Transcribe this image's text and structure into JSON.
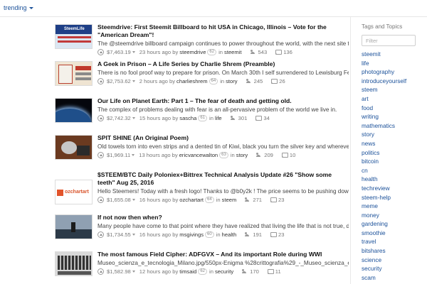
{
  "header": {
    "sort_label": "trending"
  },
  "posts": [
    {
      "title": "Steemdrive: First Steemit Billboard to hit USA in Chicago, Illinois – Vote for the \"American Dream\"!",
      "summary": "The @steemdrive billboard campaign continues to power throughout the world, with the next site targeted in",
      "payout": "$7,463.19",
      "time": "23 hours ago",
      "author": "steemdrive",
      "rep": "62",
      "category": "steemit",
      "votes": "543",
      "comments": "136"
    },
    {
      "title": "A Geek in Prison – A Life Series by Charlie Shrem (Preamble)",
      "summary": "There is no fool proof way to prepare for prison. On March 30th I self surrendered to Lewisburg Federal P",
      "payout": "$2,753.62",
      "time": "2 hours ago",
      "author": "charlieshrem",
      "rep": "64",
      "category": "story",
      "votes": "245",
      "comments": "26"
    },
    {
      "title": "Our Life on Planet Earth: Part 1 – The fear of death and getting old.",
      "summary": "The complex of problems dealing with fear is an all-pervasive problem of the world we live in.",
      "payout": "$2,742.32",
      "time": "15 hours ago",
      "author": "sascha",
      "rep": "61",
      "category": "life",
      "votes": "301",
      "comments": "34"
    },
    {
      "title": "SPIT SHINE (An Original Poem)",
      "summary": "Old towels torn into even strips and a dented tin of Kiwi, black you turn the silver key and wherever you",
      "payout": "$1,969.11",
      "time": "13 hours ago",
      "author": "ericvancewalton",
      "rep": "63",
      "category": "story",
      "votes": "209",
      "comments": "10"
    },
    {
      "title": "$STEEM/BTC Daily Poloniex+Bittrex Technical Analysis Update #26 \"Show some teeth\" Aug 25, 2016",
      "summary": "Hello Steemers! Today with a fresh logo! Thanks to @b0y2k ! The price seems to be pushing down but is ot",
      "payout": "$1,655.08",
      "time": "16 hours ago",
      "author": "ozchartart",
      "rep": "64",
      "category": "steem",
      "votes": "271",
      "comments": "23"
    },
    {
      "title": "If not now then when?",
      "summary": "Many people have come to that point where they have realized that living the life that is not true, does no",
      "payout": "$1,734.55",
      "time": "16 hours ago",
      "author": "msgivings",
      "rep": "60",
      "category": "health",
      "votes": "191",
      "comments": "23"
    },
    {
      "title": "The most famous Field Cipher: ADFGVX – And its important Role during WWI",
      "summary": "Museo_scienza_e_tecnologia_Milano.jpg/550px-Enigma %28crittografia%29_-_Museo_scienza_e_tecnolo",
      "payout": "$1,582.98",
      "time": "12 hours ago",
      "author": "timsaid",
      "rep": "62",
      "category": "security",
      "votes": "170",
      "comments": "11"
    }
  ],
  "thumb_texts": {
    "steemdrive": "SteemLife",
    "ozchartart": "ozchartart"
  },
  "sidebar": {
    "title": "Tags and Topics",
    "filter_placeholder": "Filter",
    "tags": [
      "steemit",
      "life",
      "photography",
      "introduceyourself",
      "steem",
      "art",
      "food",
      "writing",
      "mathematics",
      "story",
      "news",
      "politics",
      "bitcoin",
      "cn",
      "health",
      "techreview",
      "steem-help",
      "meme",
      "money",
      "gardening",
      "smoothie",
      "travel",
      "bitshares",
      "science",
      "security",
      "scam"
    ]
  },
  "colors": {
    "link": "#1a5099",
    "title": "#111111",
    "meta": "#777777"
  }
}
